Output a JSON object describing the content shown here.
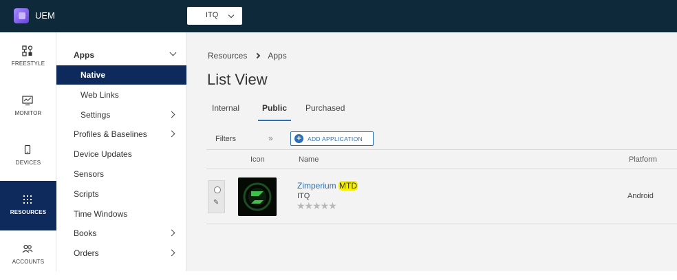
{
  "header": {
    "app_title": "UEM",
    "org_selector": {
      "value": "ITQ"
    }
  },
  "rail": {
    "items": [
      {
        "label": "FREESTYLE",
        "icon": "freestyle-icon",
        "active": false
      },
      {
        "label": "MONITOR",
        "icon": "monitor-icon",
        "active": false
      },
      {
        "label": "DEVICES",
        "icon": "devices-icon",
        "active": false
      },
      {
        "label": "RESOURCES",
        "icon": "resources-icon",
        "active": true
      },
      {
        "label": "ACCOUNTS",
        "icon": "accounts-icon",
        "active": false
      }
    ]
  },
  "nav": {
    "items": [
      {
        "label": "Apps",
        "expanded": true
      },
      {
        "label": "Native",
        "active": true
      },
      {
        "label": "Web Links"
      },
      {
        "label": "Settings",
        "has_children": true
      },
      {
        "label": "Profiles & Baselines",
        "has_children": true
      },
      {
        "label": "Device Updates"
      },
      {
        "label": "Sensors"
      },
      {
        "label": "Scripts"
      },
      {
        "label": "Time Windows"
      },
      {
        "label": "Books",
        "has_children": true
      },
      {
        "label": "Orders",
        "has_children": true
      }
    ]
  },
  "breadcrumb": [
    "Resources",
    "Apps"
  ],
  "page_title": "List View",
  "tabs": [
    {
      "label": "Internal",
      "active": false
    },
    {
      "label": "Public",
      "active": true
    },
    {
      "label": "Purchased",
      "active": false
    }
  ],
  "toolbar": {
    "filters_label": "Filters",
    "collapse_glyph": "»",
    "add_button_label": "ADD APPLICATION"
  },
  "table": {
    "columns": [
      "Icon",
      "Name",
      "Platform"
    ],
    "rows": [
      {
        "name_prefix": "Zimperium ",
        "name_highlight": "MTD",
        "organization": "ITQ",
        "rating_stars": 0,
        "platform": "Android"
      }
    ]
  },
  "colors": {
    "topbar": "#0e2a3a",
    "active_nav": "#0e2a5c",
    "accent": "#2a6fb5",
    "highlight": "#f6f000"
  }
}
